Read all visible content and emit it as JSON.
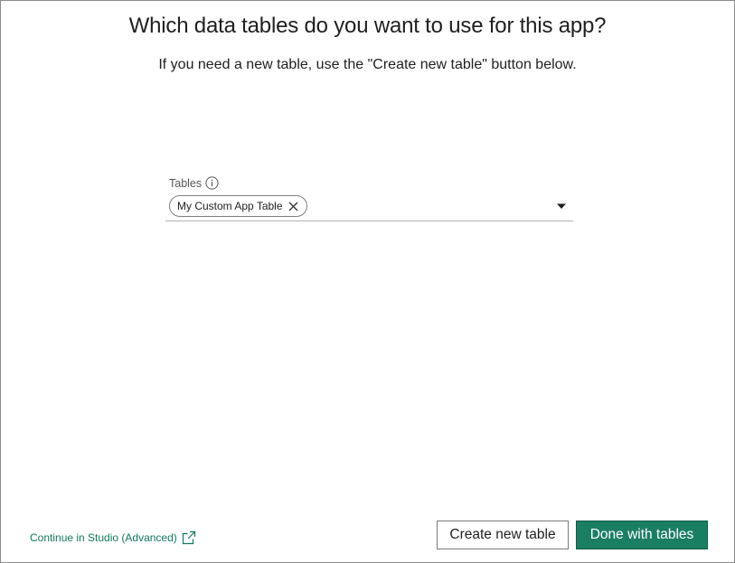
{
  "dialog": {
    "title": "Which data tables do you want to use for this app?",
    "subtitle": "If you need a new table, use the \"Create new table\" button below."
  },
  "tables_field": {
    "label": "Tables",
    "info_icon": "info-icon",
    "selected": [
      {
        "label": "My Custom App Table"
      }
    ],
    "dropdown_icon": "caret-down-icon"
  },
  "footer": {
    "studio_link": "Continue in Studio (Advanced)",
    "studio_link_icon": "external-link-icon",
    "create_button": "Create new table",
    "done_button": "Done with tables"
  },
  "colors": {
    "accent": "#1a7e63",
    "link": "#117a5d"
  }
}
